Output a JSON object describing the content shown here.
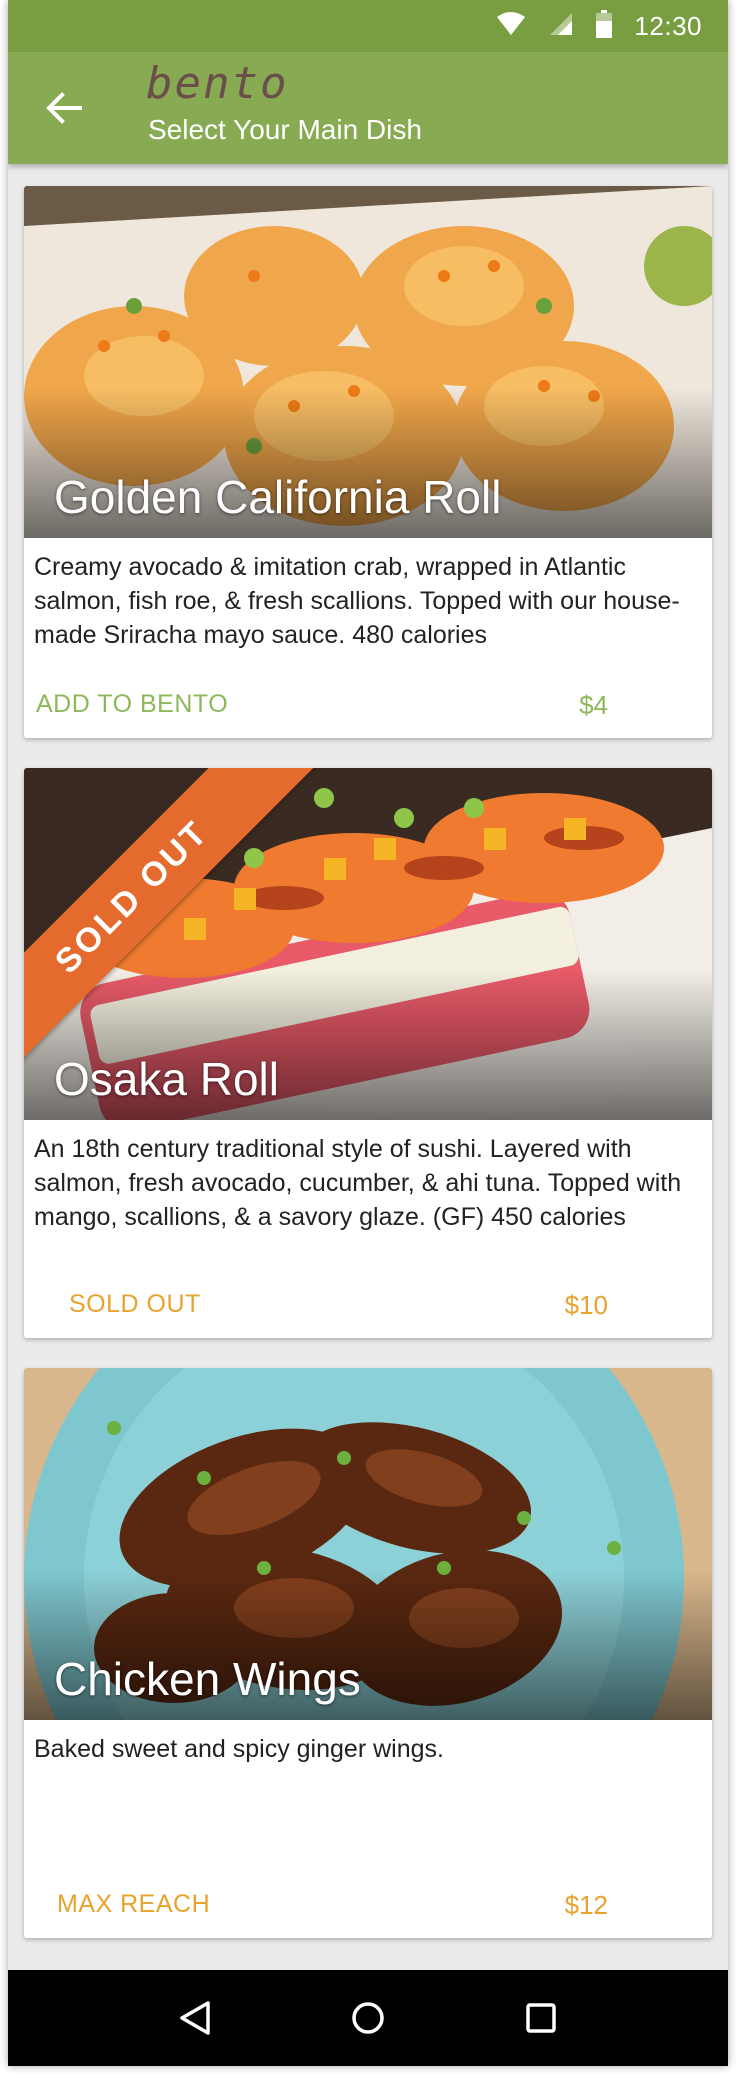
{
  "status_bar": {
    "time": "12:30",
    "icons": [
      "wifi-icon",
      "signal-icon",
      "battery-icon"
    ]
  },
  "app_bar": {
    "logo": "bento",
    "title": "Select Your Main Dish",
    "back_icon": "arrow-back-icon"
  },
  "dishes": [
    {
      "name": "Golden California Roll",
      "description": "Creamy avocado & imitation crab, wrapped in Atlantic salmon, fish roe, & fresh scallions. Topped with our house-made Sriracha mayo sauce. 480 calories",
      "action": "ADD TO BENTO",
      "price": "$4",
      "badge": ""
    },
    {
      "name": "Osaka Roll",
      "description": "An 18th century traditional style of sushi. Layered with salmon, fresh avocado, cucumber, & ahi tuna. Topped with mango, scallions, & a savory glaze. (GF) 450 calories",
      "action": "SOLD OUT",
      "price": "$10",
      "badge": "SOLD OUT"
    },
    {
      "name": "Chicken Wings",
      "description": "Baked sweet and spicy ginger wings.",
      "action": "MAX REACH",
      "price": "$12",
      "badge": ""
    }
  ],
  "colors": {
    "primary": "#88aa52",
    "primary_dark": "#799e41",
    "action_green": "#8db85a",
    "action_orange": "#e8a32e",
    "ribbon": "#e56a2d"
  },
  "nav_bar": {
    "icons": [
      "back-triangle-icon",
      "home-circle-icon",
      "recents-square-icon"
    ]
  }
}
